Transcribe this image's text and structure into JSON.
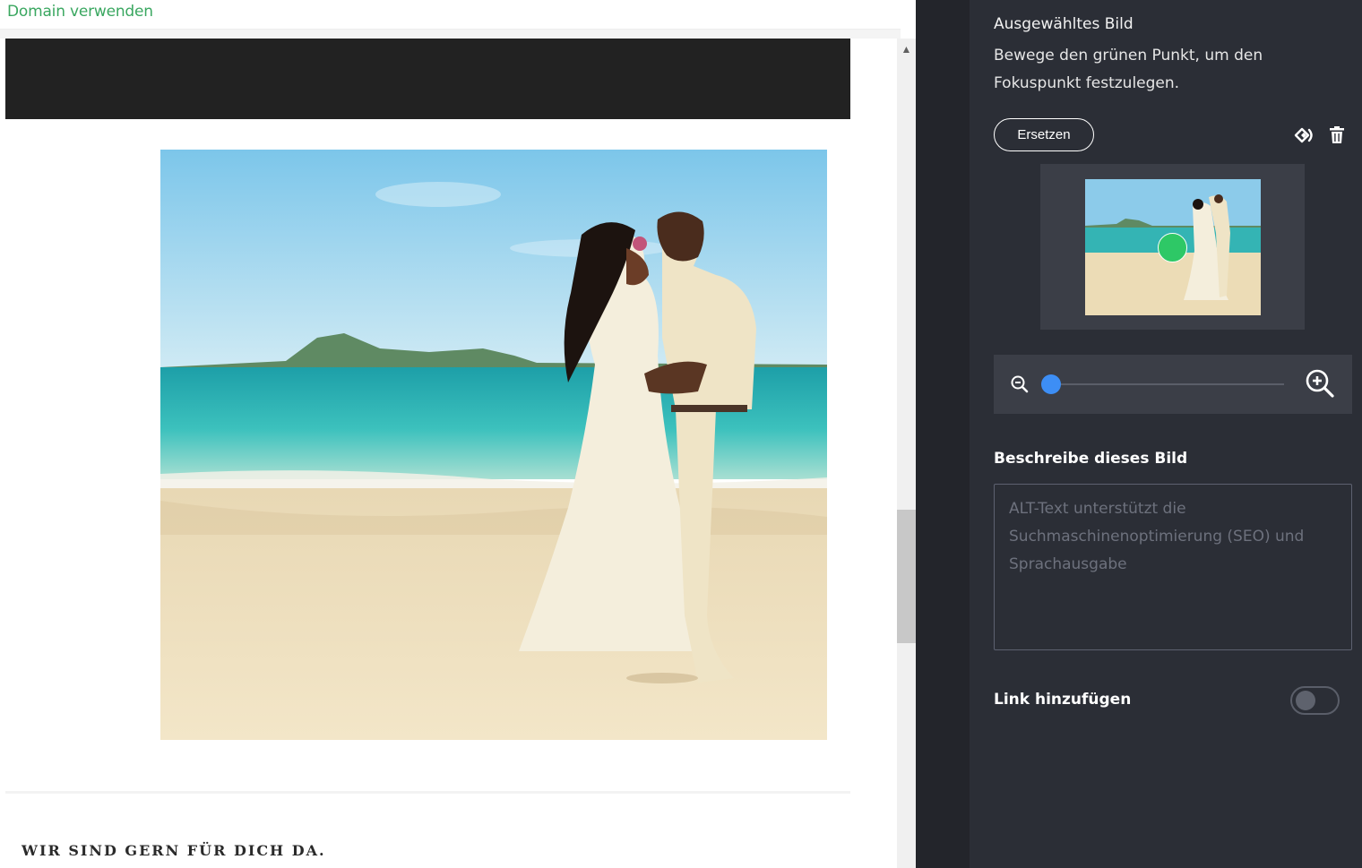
{
  "editor": {
    "domain_link": "Domain verwenden",
    "footer_heading": "WIR SIND GERN FÜR DICH DA."
  },
  "panel": {
    "title": "Ausgewähltes Bild",
    "description": "Bewege den grünen Punkt, um den Fokuspunkt festzulegen.",
    "replace_label": "Ersetzen",
    "zoom_level": 0,
    "alt_label": "Beschreibe dieses Bild",
    "alt_placeholder": "ALT-Text unterstützt die Suchmaschinenoptimierung (SEO) und Sprachausgabe",
    "alt_value": "",
    "link_label": "Link hinzufügen",
    "link_enabled": false
  },
  "colors": {
    "accent_green": "#3aa760",
    "focus_dot": "#2ec866",
    "slider_knob": "#3d8ef5",
    "panel_bg": "#2b2e36"
  },
  "icons": {
    "swap": "swap-icon",
    "trash": "trash-icon",
    "zoom_out": "zoom-out-icon",
    "zoom_in": "zoom-in-icon",
    "scroll_up": "chevron-up-icon"
  }
}
